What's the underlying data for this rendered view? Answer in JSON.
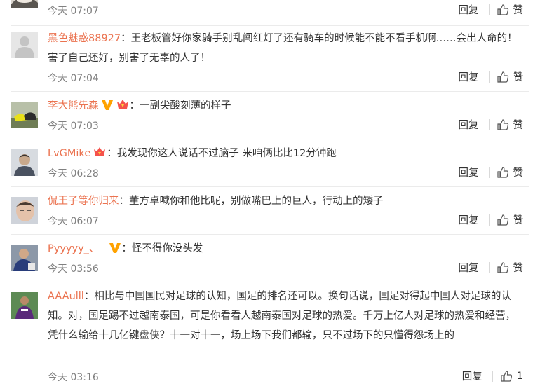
{
  "labels": {
    "reply": "回复",
    "like": "赞"
  },
  "comments": [
    {
      "user": "",
      "text": "",
      "time": "今天 07:07",
      "like": "赞",
      "avatar": "avatar-bear"
    },
    {
      "user": "黑色魅惑88927",
      "text": "：王老板管好你家骑手别乱闯红灯了还有骑车的时候能不能不看手机啊……会出人命的！害了自己还好，别害了无辜的人了！",
      "time": "今天 07:04",
      "like": "赞",
      "avatar": "avatar-default"
    },
    {
      "user": "李大熊先森",
      "text": "：一副尖酸刻薄的样子",
      "time": "今天 07:03",
      "like": "赞",
      "avatar": "avatar-shoes",
      "badges": [
        "verified-v-icon",
        "vip-crown-icon"
      ]
    },
    {
      "user": "LvGMike",
      "text": "：我发现你这人说话不过脑子 来咱俩比比12分钟跑",
      "time": "今天 06:28",
      "like": "赞",
      "avatar": "avatar-boy",
      "badges": [
        "vip-crown-icon"
      ]
    },
    {
      "user": "侃王子等你归来",
      "text": "：董方卓喊你和他比呢，别做嘴巴上的巨人，行动上的矮子",
      "time": "今天 06:07",
      "like": "赞",
      "avatar": "avatar-face"
    },
    {
      "user": "Pyyyyy_、",
      "text": "：怪不得你没头发",
      "time": "今天 03:56",
      "like": "赞",
      "avatar": "avatar-player",
      "badges": [
        "verified-v-icon"
      ]
    },
    {
      "user": "AAAulll",
      "text": "：相比与中国国民对足球的认知，国足的排名还可以。换句话说，国足对得起中国人对足球的认知。对，国足踢不过越南泰国，可是你看看人越南泰国对足球的热爱。千万上亿人对足球的热爱和经营，凭什么输给十几亿键盘侠？十一对十一，场上场下我们都输，只不过场下的只懂得怨场上的",
      "time": "今天 03:16",
      "like": "1",
      "avatar": "avatar-footballer"
    }
  ],
  "colors": {
    "username": "#eb7350",
    "time": "#808080",
    "separator": "#ebebeb",
    "badge_v": "#ffa200",
    "badge_crown": "#f5524b"
  }
}
